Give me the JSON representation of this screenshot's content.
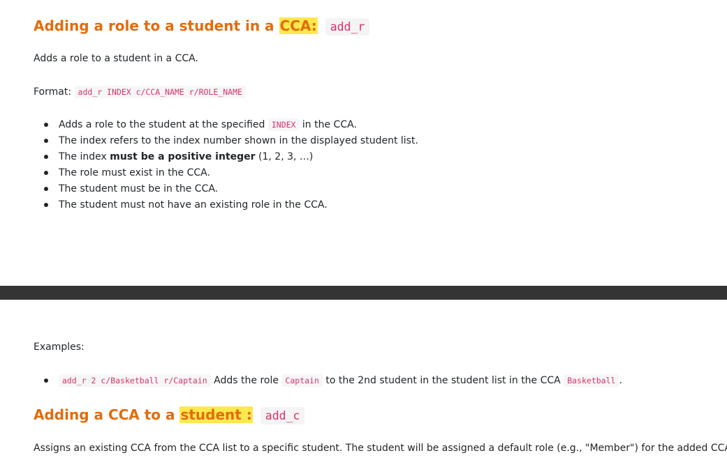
{
  "section1": {
    "heading_text": "Adding a role to a student in a ",
    "heading_mark": "CCA:",
    "heading_code": "add_r",
    "description": "Adds a role to a student in a CCA.",
    "format_label": "Format:",
    "format_code": "add_r INDEX c/CCA_NAME r/ROLE_NAME",
    "bullets": {
      "b1_pre": "Adds a role to the student at the specified",
      "b1_code": "INDEX",
      "b1_post": "in the CCA.",
      "b2": "The index refers to the index number shown in the displayed student list.",
      "b3_pre": "The index ",
      "b3_bold": "must be a positive integer",
      "b3_post": " (1, 2, 3, …)",
      "b4": "The role must exist in the CCA.",
      "b5": "The student must be in the CCA.",
      "b6": "The student must not have an existing role in the CCA."
    }
  },
  "examples": {
    "label": "Examples:",
    "ex1_code": "add_r 2 c/Basketball r/Captain",
    "ex1_text1": "Adds the role",
    "ex1_code2": "Captain",
    "ex1_text2": "to the 2nd student in the student list in the CCA",
    "ex1_code3": "Basketball",
    "ex1_text3": "."
  },
  "section2": {
    "heading_text": "Adding a CCA to a ",
    "heading_mark": "student :",
    "heading_code": "add_c",
    "description": "Assigns an existing CCA from the CCA list to a specific student. The student will be assigned a default role (e.g., \"Member\") for the added CCA."
  },
  "colors": {
    "heading": "#e36c0a",
    "highlight": "#fde94e",
    "inline_code": "#d6336c",
    "band": "#343434"
  }
}
